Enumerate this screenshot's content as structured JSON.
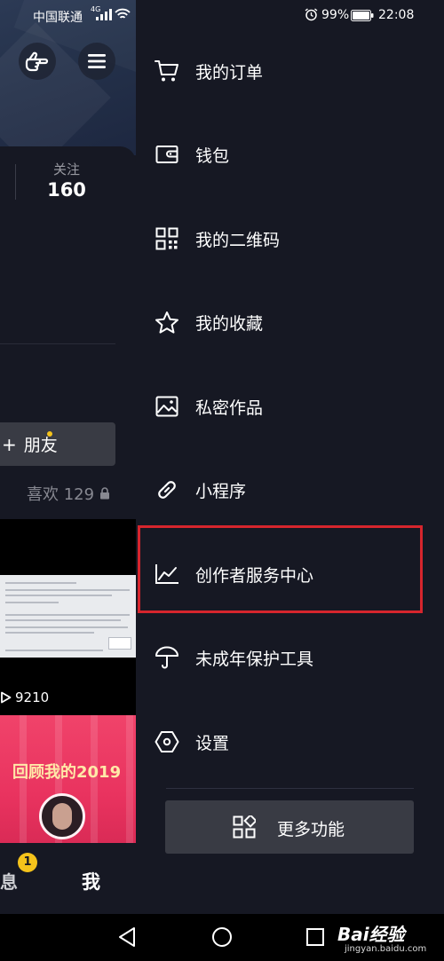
{
  "status_bar": {
    "carrier": "中国联通",
    "network": "4G",
    "battery": "99%",
    "time": "22:08"
  },
  "profile": {
    "follow_label": "关注",
    "follow_count": "160",
    "add_friend_label": "朋友",
    "likes_tab": "喜欢 129",
    "play_count": "9210",
    "video_caption": "回顾我的2019",
    "tabs": {
      "message": "息",
      "message_badge": "1",
      "me": "我"
    }
  },
  "menu": {
    "items": [
      {
        "label": "我的订单",
        "icon": "shopping-cart-icon"
      },
      {
        "label": "钱包",
        "icon": "wallet-icon"
      },
      {
        "label": "我的二维码",
        "icon": "qr-code-icon"
      },
      {
        "label": "我的收藏",
        "icon": "star-icon"
      },
      {
        "label": "私密作品",
        "icon": "image-icon"
      },
      {
        "label": "小程序",
        "icon": "link-icon"
      },
      {
        "label": "创作者服务中心",
        "icon": "chart-icon",
        "highlighted": true
      },
      {
        "label": "未成年保护工具",
        "icon": "umbrella-icon"
      },
      {
        "label": "设置",
        "icon": "hexagon-gear-icon"
      }
    ],
    "more_label": "更多功能"
  },
  "watermark": {
    "brand": "Bai经验",
    "url": "jingyan.baidu.com"
  },
  "colors": {
    "background": "#161823",
    "button_bg": "#393b44",
    "highlight": "#d6252d",
    "badge": "#f5c31b"
  }
}
